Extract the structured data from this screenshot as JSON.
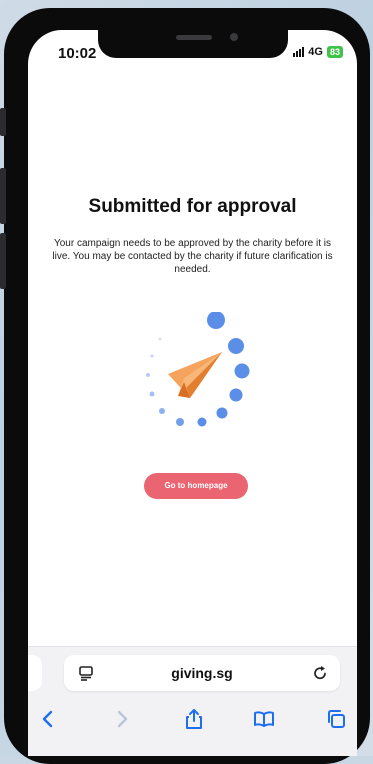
{
  "status_bar": {
    "time": "10:02",
    "network": "4G",
    "battery": "83"
  },
  "content": {
    "title": "Submitted for approval",
    "description": "Your campaign needs to be approved by the charity before it is live. You may be contacted by the charity if future clarification is needed.",
    "home_button_label": "Go to homepage",
    "accent_color": "#ea6472",
    "plane_color": "#f39a4f",
    "dots_color": "#5b8ee6"
  },
  "browser": {
    "url": "giving.sg"
  },
  "icons": {
    "reader": "reader-mode-icon",
    "reload": "reload-icon",
    "back": "chevron-left-icon",
    "forward": "chevron-right-icon",
    "share": "share-icon",
    "bookmarks": "book-icon",
    "tabs": "tabs-icon"
  }
}
